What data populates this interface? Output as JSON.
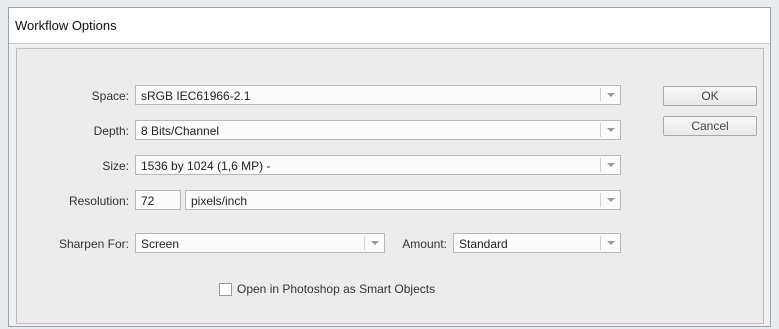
{
  "window": {
    "title": "Workflow Options"
  },
  "labels": {
    "space": "Space:",
    "depth": "Depth:",
    "size": "Size:",
    "resolution": "Resolution:",
    "sharpen_for": "Sharpen For:",
    "amount": "Amount:"
  },
  "fields": {
    "space": "sRGB IEC61966-2.1",
    "depth": "8 Bits/Channel",
    "size": "1536 by 1024  (1,6 MP)  -",
    "resolution_value": "72",
    "resolution_unit": "pixels/inch",
    "sharpen_for": "Screen",
    "amount": "Standard"
  },
  "buttons": {
    "ok": "OK",
    "cancel": "Cancel"
  },
  "checkbox": {
    "smart_objects_label": "Open in Photoshop as Smart Objects",
    "checked": false
  }
}
